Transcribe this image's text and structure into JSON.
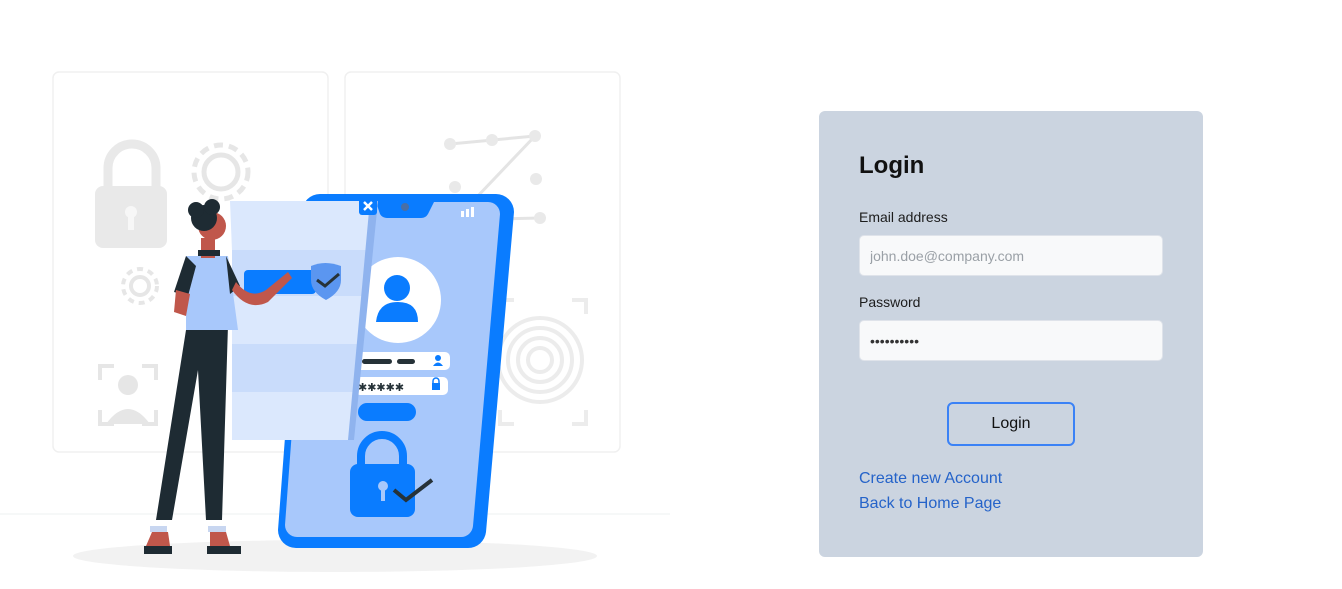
{
  "login": {
    "title": "Login",
    "email_label": "Email address",
    "email_placeholder": "john.doe@company.com",
    "password_label": "Password",
    "password_value": "••••••••••",
    "submit_label": "Login",
    "create_account_link": "Create new Account",
    "back_home_link": "Back to Home Page"
  },
  "illustration": {
    "password_mask": "✱✱✱✱✱",
    "colors": {
      "primary": "#0a7cff",
      "light": "#a8c8fb",
      "pale": "#dbe8fd"
    }
  }
}
